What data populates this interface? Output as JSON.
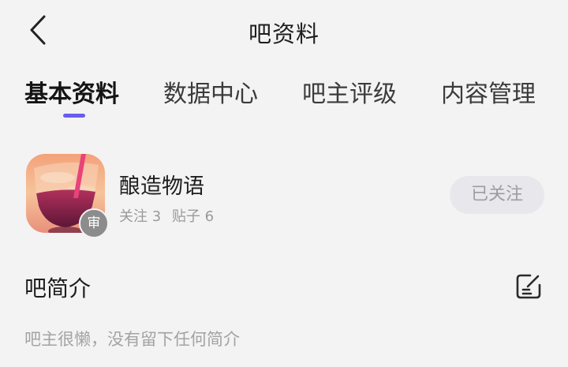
{
  "header": {
    "title": "吧资料"
  },
  "tabs": [
    {
      "label": "基本资料",
      "active": true
    },
    {
      "label": "数据中心",
      "active": false
    },
    {
      "label": "吧主评级",
      "active": false
    },
    {
      "label": "内容管理",
      "active": false
    }
  ],
  "forum": {
    "name": "酿造物语",
    "badge": "审",
    "stats": {
      "follow": "关注 3",
      "posts": "贴子 6"
    },
    "follow_button": "已关注"
  },
  "intro": {
    "title": "吧简介",
    "text": "吧主很懒，没有留下任何简介"
  },
  "colors": {
    "accent": "#6a5cf0",
    "background": "#f3f3f3",
    "secondary_text": "#9a9a9a"
  },
  "icons": {
    "back": "chevron-left-icon",
    "edit": "edit-icon"
  }
}
